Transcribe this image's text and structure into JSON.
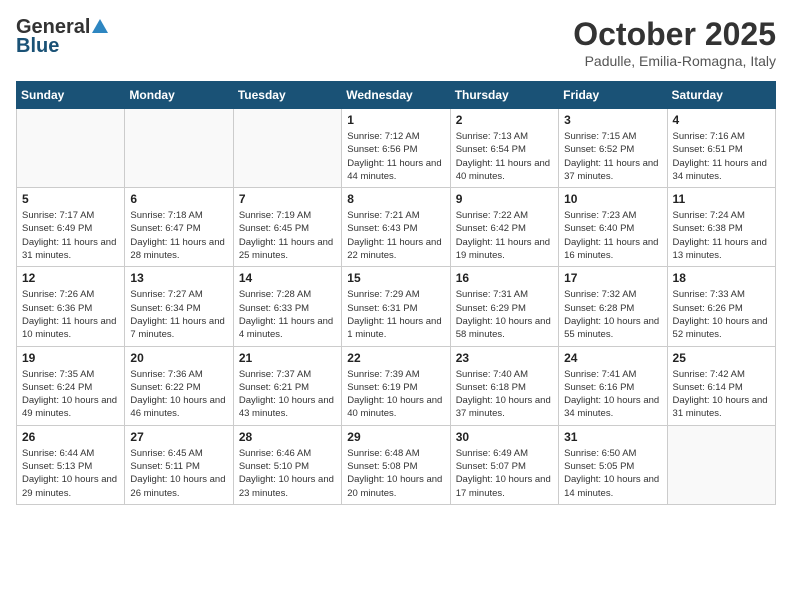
{
  "logo": {
    "general": "General",
    "blue": "Blue"
  },
  "header": {
    "month_year": "October 2025",
    "location": "Padulle, Emilia-Romagna, Italy"
  },
  "weekdays": [
    "Sunday",
    "Monday",
    "Tuesday",
    "Wednesday",
    "Thursday",
    "Friday",
    "Saturday"
  ],
  "weeks": [
    [
      {
        "day": "",
        "info": ""
      },
      {
        "day": "",
        "info": ""
      },
      {
        "day": "",
        "info": ""
      },
      {
        "day": "1",
        "info": "Sunrise: 7:12 AM\nSunset: 6:56 PM\nDaylight: 11 hours and 44 minutes."
      },
      {
        "day": "2",
        "info": "Sunrise: 7:13 AM\nSunset: 6:54 PM\nDaylight: 11 hours and 40 minutes."
      },
      {
        "day": "3",
        "info": "Sunrise: 7:15 AM\nSunset: 6:52 PM\nDaylight: 11 hours and 37 minutes."
      },
      {
        "day": "4",
        "info": "Sunrise: 7:16 AM\nSunset: 6:51 PM\nDaylight: 11 hours and 34 minutes."
      }
    ],
    [
      {
        "day": "5",
        "info": "Sunrise: 7:17 AM\nSunset: 6:49 PM\nDaylight: 11 hours and 31 minutes."
      },
      {
        "day": "6",
        "info": "Sunrise: 7:18 AM\nSunset: 6:47 PM\nDaylight: 11 hours and 28 minutes."
      },
      {
        "day": "7",
        "info": "Sunrise: 7:19 AM\nSunset: 6:45 PM\nDaylight: 11 hours and 25 minutes."
      },
      {
        "day": "8",
        "info": "Sunrise: 7:21 AM\nSunset: 6:43 PM\nDaylight: 11 hours and 22 minutes."
      },
      {
        "day": "9",
        "info": "Sunrise: 7:22 AM\nSunset: 6:42 PM\nDaylight: 11 hours and 19 minutes."
      },
      {
        "day": "10",
        "info": "Sunrise: 7:23 AM\nSunset: 6:40 PM\nDaylight: 11 hours and 16 minutes."
      },
      {
        "day": "11",
        "info": "Sunrise: 7:24 AM\nSunset: 6:38 PM\nDaylight: 11 hours and 13 minutes."
      }
    ],
    [
      {
        "day": "12",
        "info": "Sunrise: 7:26 AM\nSunset: 6:36 PM\nDaylight: 11 hours and 10 minutes."
      },
      {
        "day": "13",
        "info": "Sunrise: 7:27 AM\nSunset: 6:34 PM\nDaylight: 11 hours and 7 minutes."
      },
      {
        "day": "14",
        "info": "Sunrise: 7:28 AM\nSunset: 6:33 PM\nDaylight: 11 hours and 4 minutes."
      },
      {
        "day": "15",
        "info": "Sunrise: 7:29 AM\nSunset: 6:31 PM\nDaylight: 11 hours and 1 minute."
      },
      {
        "day": "16",
        "info": "Sunrise: 7:31 AM\nSunset: 6:29 PM\nDaylight: 10 hours and 58 minutes."
      },
      {
        "day": "17",
        "info": "Sunrise: 7:32 AM\nSunset: 6:28 PM\nDaylight: 10 hours and 55 minutes."
      },
      {
        "day": "18",
        "info": "Sunrise: 7:33 AM\nSunset: 6:26 PM\nDaylight: 10 hours and 52 minutes."
      }
    ],
    [
      {
        "day": "19",
        "info": "Sunrise: 7:35 AM\nSunset: 6:24 PM\nDaylight: 10 hours and 49 minutes."
      },
      {
        "day": "20",
        "info": "Sunrise: 7:36 AM\nSunset: 6:22 PM\nDaylight: 10 hours and 46 minutes."
      },
      {
        "day": "21",
        "info": "Sunrise: 7:37 AM\nSunset: 6:21 PM\nDaylight: 10 hours and 43 minutes."
      },
      {
        "day": "22",
        "info": "Sunrise: 7:39 AM\nSunset: 6:19 PM\nDaylight: 10 hours and 40 minutes."
      },
      {
        "day": "23",
        "info": "Sunrise: 7:40 AM\nSunset: 6:18 PM\nDaylight: 10 hours and 37 minutes."
      },
      {
        "day": "24",
        "info": "Sunrise: 7:41 AM\nSunset: 6:16 PM\nDaylight: 10 hours and 34 minutes."
      },
      {
        "day": "25",
        "info": "Sunrise: 7:42 AM\nSunset: 6:14 PM\nDaylight: 10 hours and 31 minutes."
      }
    ],
    [
      {
        "day": "26",
        "info": "Sunrise: 6:44 AM\nSunset: 5:13 PM\nDaylight: 10 hours and 29 minutes."
      },
      {
        "day": "27",
        "info": "Sunrise: 6:45 AM\nSunset: 5:11 PM\nDaylight: 10 hours and 26 minutes."
      },
      {
        "day": "28",
        "info": "Sunrise: 6:46 AM\nSunset: 5:10 PM\nDaylight: 10 hours and 23 minutes."
      },
      {
        "day": "29",
        "info": "Sunrise: 6:48 AM\nSunset: 5:08 PM\nDaylight: 10 hours and 20 minutes."
      },
      {
        "day": "30",
        "info": "Sunrise: 6:49 AM\nSunset: 5:07 PM\nDaylight: 10 hours and 17 minutes."
      },
      {
        "day": "31",
        "info": "Sunrise: 6:50 AM\nSunset: 5:05 PM\nDaylight: 10 hours and 14 minutes."
      },
      {
        "day": "",
        "info": ""
      }
    ]
  ]
}
